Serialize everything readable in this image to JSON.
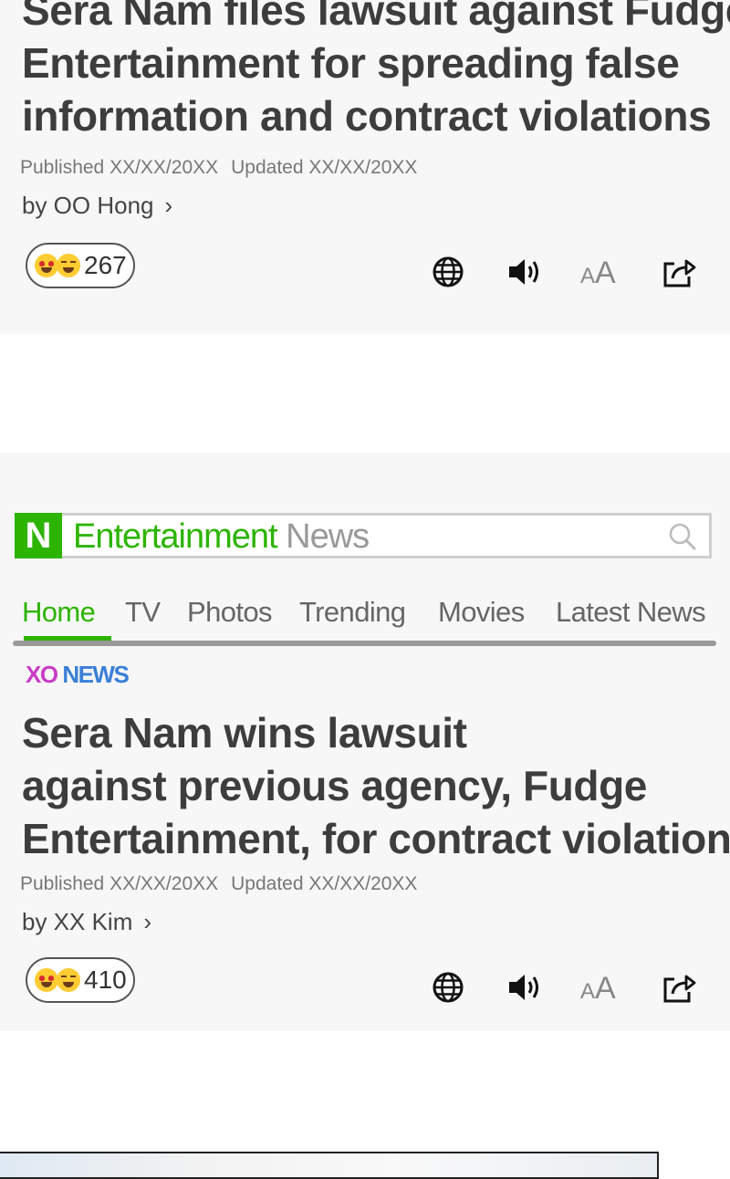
{
  "article1": {
    "headline_lines": [
      "Sera Nam files lawsuit against Fudge",
      "Entertainment for spreading false",
      "information and contract violations"
    ],
    "published": "Published XX/XX/20XX",
    "updated": "Updated XX/XX/20XX",
    "byline": "by OO Hong",
    "byline_chevron": "›",
    "reaction_count": "267",
    "tools": {
      "translate_icon": "globe-icon",
      "audio_icon": "speaker-icon",
      "font_small": "A",
      "font_large": "A",
      "share_icon": "share-icon"
    }
  },
  "portal": {
    "logo": "N",
    "brand_primary": "Entertainment",
    "brand_secondary": "News",
    "search_icon": "search-icon",
    "brand_color": "#2db400",
    "nav": [
      "Home",
      "TV",
      "Photos",
      "Trending",
      "Movies",
      "Latest News"
    ],
    "active_nav": "Home"
  },
  "article2": {
    "source_part1": "XO",
    "source_part2": "NEWS",
    "headline_lines": [
      "Sera Nam wins lawsuit",
      "against previous agency, Fudge",
      "Entertainment, for contract violations"
    ],
    "published": "Published XX/XX/20XX",
    "updated": "Updated XX/XX/20XX",
    "byline": "by XX Kim",
    "byline_chevron": "›",
    "reaction_count": "410",
    "tools": {
      "translate_icon": "globe-icon",
      "audio_icon": "speaker-icon",
      "font_small": "A",
      "font_large": "A",
      "share_icon": "share-icon"
    }
  }
}
